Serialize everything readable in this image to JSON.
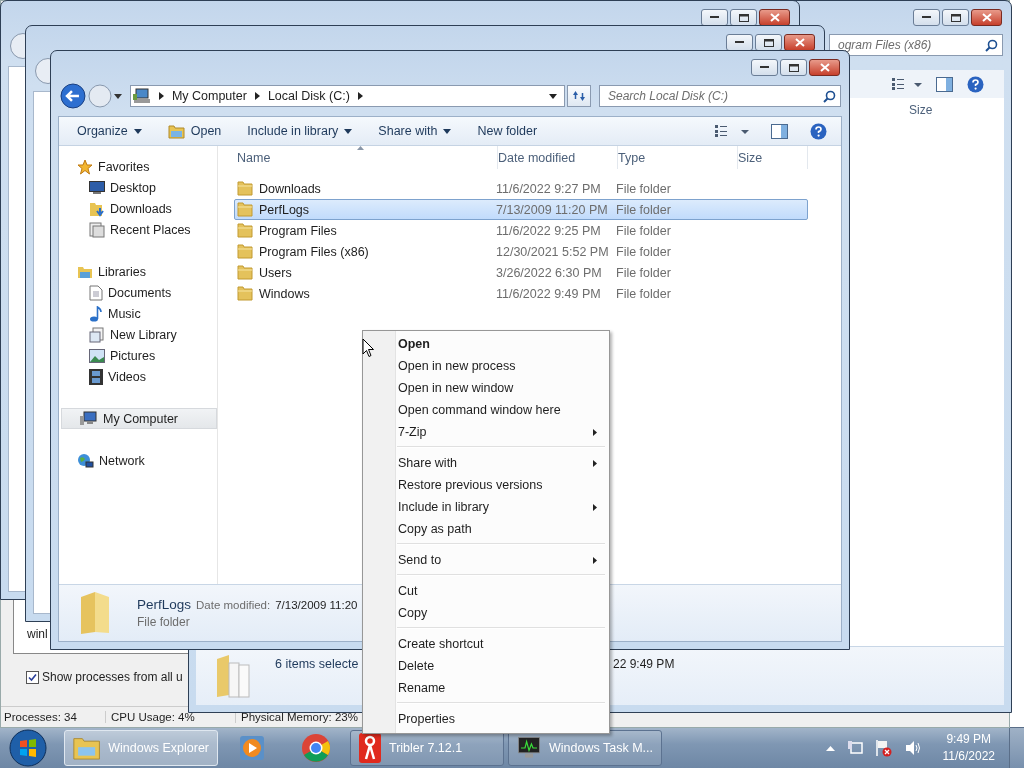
{
  "task_manager": {
    "process_text": "winl",
    "show_all": {
      "label": "Show processes from all u",
      "checked": true
    },
    "status_bar": [
      "Processes: 34",
      "CPU Usage: 4%",
      "Physical Memory: 23%"
    ]
  },
  "back_explorer": {
    "search": "ogram Files (x86)",
    "column": "Size",
    "details": {
      "summary": "6 items selecte",
      "date": "22 9:49 PM"
    }
  },
  "explorer": {
    "breadcrumb": [
      "My Computer",
      "Local Disk (C:)"
    ],
    "search": {
      "placeholder": "Search Local Disk (C:)"
    },
    "toolbar": [
      {
        "label": "Organize",
        "kind": "plain",
        "dropdown": true
      },
      {
        "label": "Open",
        "kind": "with-icon",
        "dropdown": false
      },
      {
        "label": "Include in library",
        "kind": "plain",
        "dropdown": true
      },
      {
        "label": "Share with",
        "kind": "plain",
        "dropdown": true
      },
      {
        "label": "New folder",
        "kind": "plain",
        "dropdown": false
      }
    ],
    "nav": [
      {
        "label": "Favorites",
        "kind": "star",
        "selected": false,
        "children": [
          {
            "label": "Desktop",
            "kind": "desktop",
            "selected": false
          },
          {
            "label": "Downloads",
            "kind": "downloads",
            "selected": false
          },
          {
            "label": "Recent Places",
            "kind": "recent",
            "selected": false
          }
        ]
      },
      {
        "label": "Libraries",
        "kind": "library",
        "selected": false,
        "children": [
          {
            "label": "Documents",
            "kind": "document",
            "selected": false
          },
          {
            "label": "Music",
            "kind": "music",
            "selected": false
          },
          {
            "label": "New Library",
            "kind": "newlib",
            "selected": false
          },
          {
            "label": "Pictures",
            "kind": "pictures",
            "selected": false
          },
          {
            "label": "Videos",
            "kind": "video",
            "selected": false
          }
        ]
      },
      {
        "label": "My Computer",
        "kind": "computer",
        "selected": true
      },
      {
        "label": "Network",
        "kind": "network",
        "selected": false
      }
    ],
    "columns": [
      {
        "label": "Name",
        "sorted": true
      },
      {
        "label": "Date modified",
        "sorted": false
      },
      {
        "label": "Type",
        "sorted": false
      },
      {
        "label": "Size",
        "sorted": false
      }
    ],
    "files": [
      {
        "name": "Downloads",
        "date": "11/6/2022 9:27 PM",
        "type": "File folder",
        "selected": false
      },
      {
        "name": "PerfLogs",
        "date": "7/13/2009 11:20 PM",
        "type": "File folder",
        "selected": true
      },
      {
        "name": "Program Files",
        "date": "11/6/2022 9:25 PM",
        "type": "File folder",
        "selected": false
      },
      {
        "name": "Program Files (x86)",
        "date": "12/30/2021 5:52 PM",
        "type": "File folder",
        "selected": false
      },
      {
        "name": "Users",
        "date": "3/26/2022 6:30 PM",
        "type": "File folder",
        "selected": false
      },
      {
        "name": "Windows",
        "date": "11/6/2022 9:49 PM",
        "type": "File folder",
        "selected": false
      }
    ],
    "details": {
      "name": "PerfLogs",
      "date_label": "Date modified:",
      "date": "7/13/2009 11:20",
      "type": "File folder"
    }
  },
  "context_menu": [
    {
      "kind": "item",
      "label": "Open",
      "default": true,
      "submenu": false
    },
    {
      "kind": "item",
      "label": "Open in new process",
      "default": false,
      "submenu": false
    },
    {
      "kind": "item",
      "label": "Open in new window",
      "default": false,
      "submenu": false
    },
    {
      "kind": "item",
      "label": "Open command window here",
      "default": false,
      "submenu": false
    },
    {
      "kind": "item",
      "label": "7-Zip",
      "default": false,
      "submenu": true
    },
    {
      "kind": "separator"
    },
    {
      "kind": "item",
      "label": "Share with",
      "default": false,
      "submenu": true
    },
    {
      "kind": "item",
      "label": "Restore previous versions",
      "default": false,
      "submenu": false
    },
    {
      "kind": "item",
      "label": "Include in library",
      "default": false,
      "submenu": true
    },
    {
      "kind": "item",
      "label": "Copy as path",
      "default": false,
      "submenu": false
    },
    {
      "kind": "separator"
    },
    {
      "kind": "item",
      "label": "Send to",
      "default": false,
      "submenu": true
    },
    {
      "kind": "separator"
    },
    {
      "kind": "item",
      "label": "Cut",
      "default": false,
      "submenu": false
    },
    {
      "kind": "item",
      "label": "Copy",
      "default": false,
      "submenu": false
    },
    {
      "kind": "separator"
    },
    {
      "kind": "item",
      "label": "Create shortcut",
      "default": false,
      "submenu": false
    },
    {
      "kind": "item",
      "label": "Delete",
      "default": false,
      "submenu": false
    },
    {
      "kind": "item",
      "label": "Rename",
      "default": false,
      "submenu": false
    },
    {
      "kind": "separator"
    },
    {
      "kind": "item",
      "label": "Properties",
      "default": false,
      "submenu": false
    }
  ],
  "taskbar": {
    "buttons": [
      {
        "label": "Windows Explorer",
        "kind": "explorer",
        "selected": true
      },
      {
        "kind": "media",
        "selected": false
      },
      {
        "kind": "browser",
        "selected": false
      },
      {
        "label": "Tribler 7.12.1",
        "kind": "tribler",
        "selected": false
      },
      {
        "label": "Windows Task M...",
        "kind": "monitor",
        "selected": false
      }
    ],
    "clock": {
      "time": "9:49 PM",
      "date": "11/6/2022"
    }
  }
}
